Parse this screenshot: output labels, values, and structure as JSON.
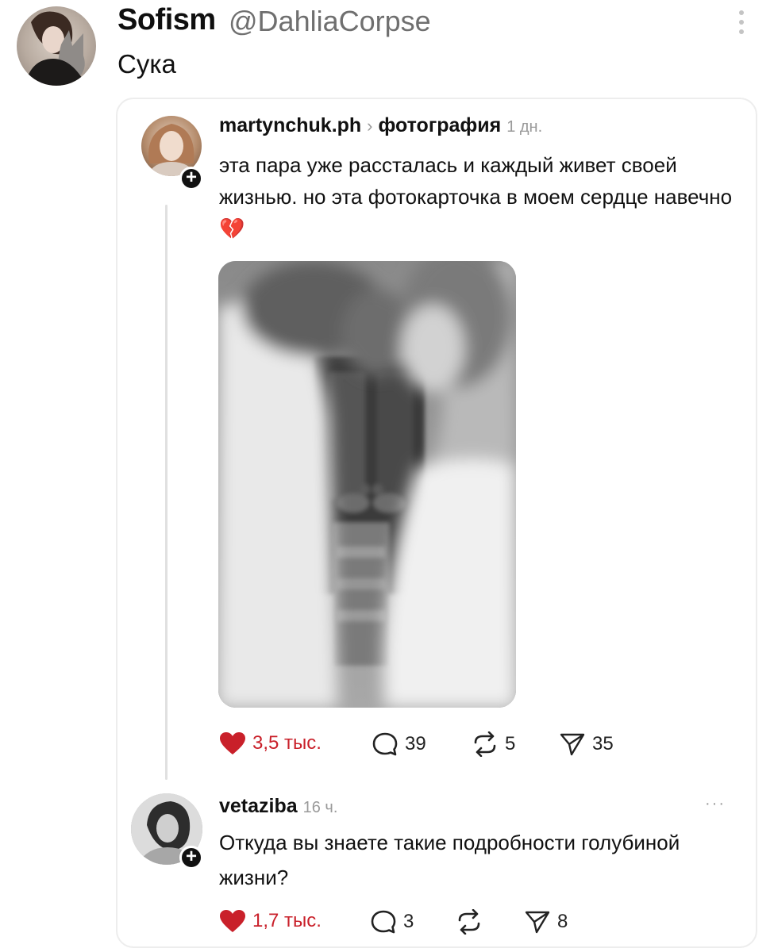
{
  "outer": {
    "display_name": "Sofism",
    "handle": "@DahliaCorpse",
    "text": "Сука"
  },
  "quoted_post": {
    "username": "martynchuk.ph",
    "separator": "›",
    "topic": "фотография",
    "time": "1 дн.",
    "text": "эта пара уже рассталась и каждый живет своей жизнью. но эта фотокарточка в моем сердце навечно",
    "emoji": "💔",
    "likes": "3,5 тыс.",
    "comments": "39",
    "reposts": "5",
    "shares": "35",
    "colors": {
      "like": "#c9202a"
    }
  },
  "reply": {
    "username": "vetaziba",
    "time": "16 ч.",
    "more": "···",
    "text": "Откуда вы знаете такие подробности голубиной жизни?",
    "likes": "1,7 тыс.",
    "comments": "3",
    "shares": "8"
  },
  "icons": {
    "more": "more-dots-icon",
    "like": "heart-icon",
    "comment": "comment-bubble-icon",
    "repost": "repost-icon",
    "share": "send-icon",
    "follow": "plus-icon"
  }
}
